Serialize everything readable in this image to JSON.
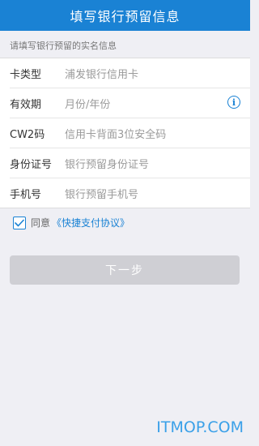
{
  "header": {
    "title": "填写银行预留信息"
  },
  "form": {
    "hint": "请填写银行预留的实名信息",
    "rows": [
      {
        "label": "卡类型",
        "value": "浦发银行信用卡"
      },
      {
        "label": "有效期",
        "value": "月份/年份"
      },
      {
        "label": "CW2码",
        "value": "信用卡背面3位安全码"
      },
      {
        "label": "身份证号",
        "value": "银行预留身份证号"
      },
      {
        "label": "手机号",
        "value": "银行预留手机号"
      }
    ],
    "info_icon_glyph": "i"
  },
  "agreement": {
    "prefix": "同意",
    "link": "《快捷支付协议》",
    "checked": true
  },
  "next_button": {
    "label": "下一步"
  },
  "watermark": "ITMOP.COM",
  "colors": {
    "accent": "#1a82d4",
    "background": "#efeff4",
    "button_disabled": "#cfcfd4"
  }
}
